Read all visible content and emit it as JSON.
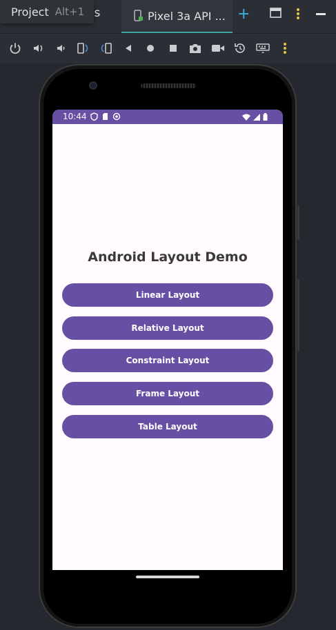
{
  "tabbar": {
    "tooltip_label": "Project",
    "tooltip_shortcut": "Alt+1",
    "hidden_tab_suffix": "es",
    "active_tab_label": "Pixel 3a API ...",
    "plus_icon": "plus-icon",
    "accent_color": "#3fa6a4"
  },
  "toolbar": {
    "icons": [
      "power-icon",
      "volume-up-icon",
      "volume-down-icon",
      "rotate-left-icon",
      "rotate-right-icon",
      "back-icon",
      "home-icon",
      "overview-icon",
      "screenshot-icon",
      "screen-record-icon",
      "snapshot-icon",
      "keyboard-icon",
      "more-icon"
    ]
  },
  "device": {
    "status": {
      "time": "10:44"
    },
    "app": {
      "title": "Android Layout Demo",
      "buttons": [
        {
          "label": "Linear Layout"
        },
        {
          "label": "Relative Layout"
        },
        {
          "label": "Constraint Layout"
        },
        {
          "label": "Frame Layout"
        },
        {
          "label": "Table Layout"
        }
      ],
      "primary_color": "#6750a4",
      "background_color": "#fffbfe"
    }
  }
}
